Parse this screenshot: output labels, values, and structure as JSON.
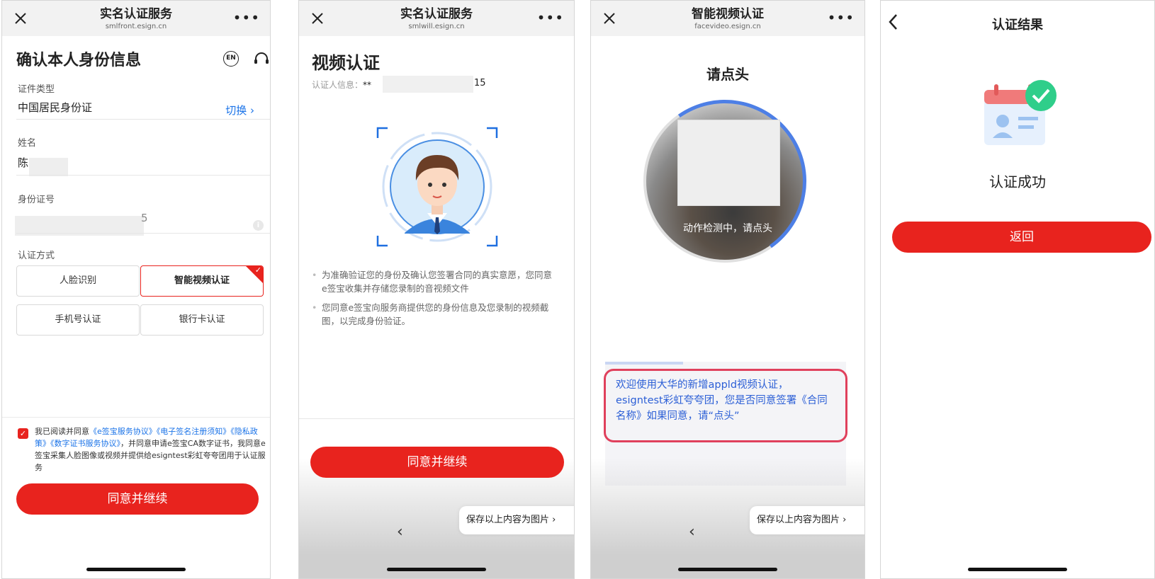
{
  "panel1": {
    "title": "实名认证服务",
    "url": "smlfront.esign.cn",
    "more": "•••",
    "heading": "确认本人身份信息",
    "en_label": "EN",
    "id_type_label": "证件类型",
    "id_type_value": "中国居民身份证",
    "switch_label": "切换 ›",
    "name_label": "姓名",
    "name_value": "陈",
    "id_no_label": "身份证号",
    "id_no_tail": "5",
    "method_label": "认证方式",
    "methods": [
      {
        "label": "人脸识别",
        "selected": false
      },
      {
        "label": "智能视频认证",
        "selected": true
      },
      {
        "label": "手机号认证",
        "selected": false
      },
      {
        "label": "银行卡认证",
        "selected": false
      }
    ],
    "agree_prefix": "我已阅读并同意",
    "agree_link1": "《e签宝服务协议》",
    "agree_link2": "《电子签名注册须知》",
    "agree_link3": "《隐私政策》",
    "agree_link4": "《数字证书服务协议》",
    "agree_suffix": "，并同意申请e签宝CA数字证书，我同意e签宝采集人脸图像或视频并提供给esigntest彩虹夸夸团用于认证服务",
    "continue_label": "同意并继续"
  },
  "panel2": {
    "title": "实名认证服务",
    "url": "smlwill.esign.cn",
    "more": "•••",
    "heading": "视频认证",
    "info_label": "认证人信息：",
    "info_value": "**",
    "info_tail": "15",
    "notes": [
      "为准确验证您的身份及确认您签署合同的真实意愿，您同意e签宝收集并存储您录制的音视频文件",
      "您同意e签宝向服务商提供您的身份信息及您录制的视频截图，以完成身份验证。"
    ],
    "continue_label": "同意并继续",
    "save_label": "保存以上内容为图片 ›",
    "back_glyph": "‹"
  },
  "panel3": {
    "title": "智能视频认证",
    "url": "facevideo.esign.cn",
    "more": "•••",
    "prompt": "请点头",
    "cam_text": "动作检测中，请点头",
    "message": "欢迎使用大华的新增appld视频认证，esigntest彩虹夸夸团，您是否同意签署《合同名称》如果同意，请“点头”",
    "save_label": "保存以上内容为图片 ›",
    "back_glyph": "‹"
  },
  "panel4": {
    "title": "认证结果",
    "status": "认证成功",
    "return_label": "返回"
  },
  "colors": {
    "brand_red": "#e8231e",
    "link_blue": "#1a73e8",
    "success_green": "#2fce8a"
  }
}
